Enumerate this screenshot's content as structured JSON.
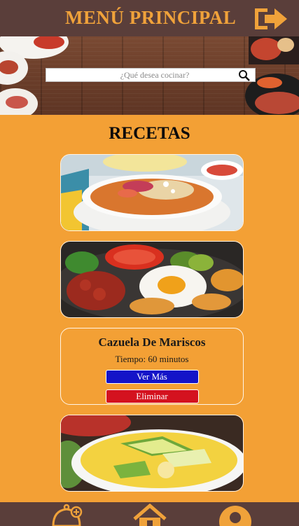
{
  "header": {
    "title": "MENÚ PRINCIPAL",
    "exit_icon": "logout-arrow-icon"
  },
  "search": {
    "placeholder": "¿Qué desea cocinar?",
    "icon": "search-icon"
  },
  "main": {
    "title": "RECETAS",
    "cards": [
      {
        "type": "image",
        "description_icon": "soup-dish-image"
      },
      {
        "type": "image",
        "description_icon": "plate-with-egg-image"
      },
      {
        "type": "info",
        "title": "Cazuela De Mariscos",
        "time": "Tiempo: 60 minutos",
        "view_label": "Ver Más",
        "delete_label": "Eliminar"
      },
      {
        "type": "image",
        "description_icon": "yellow-soup-avocado-image"
      }
    ]
  },
  "footer": {
    "items": [
      "add-recipe-cloche-icon",
      "home-icon",
      "user-profile-icon"
    ]
  },
  "colors": {
    "background": "#f3a035",
    "header": "#5a3e3a",
    "accent": "#f0a23a",
    "view_button": "#1414c8",
    "delete_button": "#d4121f"
  }
}
